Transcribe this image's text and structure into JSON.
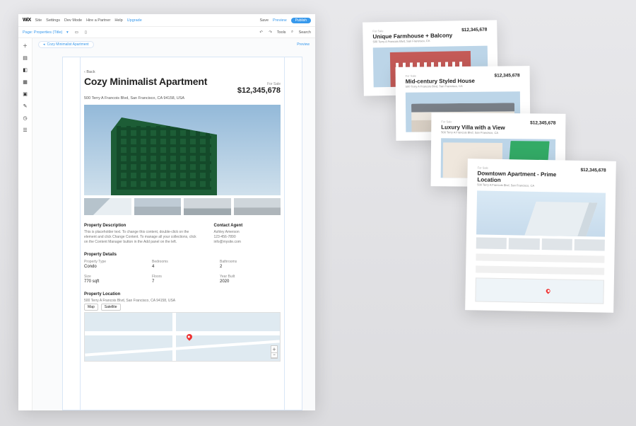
{
  "topbar": {
    "brand": "WiX",
    "menu": [
      "Site",
      "Settings",
      "Dev Mode",
      "Hire a Partner",
      "Help",
      "Upgrade"
    ],
    "save": "Save",
    "preview": "Preview",
    "publish": "Publish"
  },
  "subbar": {
    "page_label": "Page: Properties (Title)",
    "tools": "Tools",
    "search": "Search"
  },
  "tools": [
    {
      "name": "add-icon",
      "glyph": "＋"
    },
    {
      "name": "pages-icon",
      "glyph": "▤"
    },
    {
      "name": "design-icon",
      "glyph": "◧"
    },
    {
      "name": "apps-icon",
      "glyph": "▦"
    },
    {
      "name": "media-icon",
      "glyph": "▣"
    },
    {
      "name": "blog-icon",
      "glyph": "✎"
    },
    {
      "name": "bookings-icon",
      "glyph": "◷"
    },
    {
      "name": "ascend-icon",
      "glyph": "☰"
    }
  ],
  "canvas": {
    "breadcrumb_icon": "◂",
    "breadcrumb": "Cozy Minimalist Apartment",
    "preview_hint": "Preview"
  },
  "listing": {
    "back": "‹  Back",
    "title": "Cozy Minimalist Apartment",
    "status": "For Sale",
    "price": "$12,345,678",
    "address": "500 Terry A Francois Blvd, San Francisco, CA 94158, USA",
    "desc_heading": "Property Description",
    "desc_body": "This is placeholder text. To change this content, double-click on the element and click Change Content. To manage all your collections, click on the Content Manager button in the Add panel on the left.",
    "agent_heading": "Contact Agent",
    "agent_name": "Ashley Amerson",
    "agent_phone": "123-456-7890",
    "agent_email": "info@mysite.com",
    "details_heading": "Property Details",
    "details": [
      {
        "label": "Property Type",
        "value": "Condo"
      },
      {
        "label": "Bedrooms",
        "value": "4"
      },
      {
        "label": "Bathrooms",
        "value": "2"
      },
      {
        "label": "Size",
        "value": "770 sqft"
      },
      {
        "label": "Floors",
        "value": "7"
      },
      {
        "label": "Year Built",
        "value": "2020"
      }
    ],
    "location_heading": "Property Location",
    "map_tab_map": "Map",
    "map_tab_sat": "Satellite"
  },
  "stack": [
    {
      "status": "For Sale",
      "title": "Unique Farmhouse + Balcony",
      "price": "$12,345,678",
      "addr": "500 Terry A Francois Blvd, San Francisco, CA",
      "photo": "farm"
    },
    {
      "status": "For Sale",
      "title": "Mid-century Styled House",
      "price": "$12,345,678",
      "addr": "500 Terry A Francois Blvd, San Francisco, CA",
      "photo": "mid"
    },
    {
      "status": "For Sale",
      "title": "Luxury Villa with a View",
      "price": "$12,345,678",
      "addr": "500 Terry A Francois Blvd, San Francisco, CA",
      "photo": "villa"
    },
    {
      "status": "For Sale",
      "title": "Downtown Apartment - Prime Location",
      "price": "$12,345,678",
      "addr": "500 Terry A Francois Blvd, San Francisco, CA",
      "photo": "down"
    }
  ]
}
